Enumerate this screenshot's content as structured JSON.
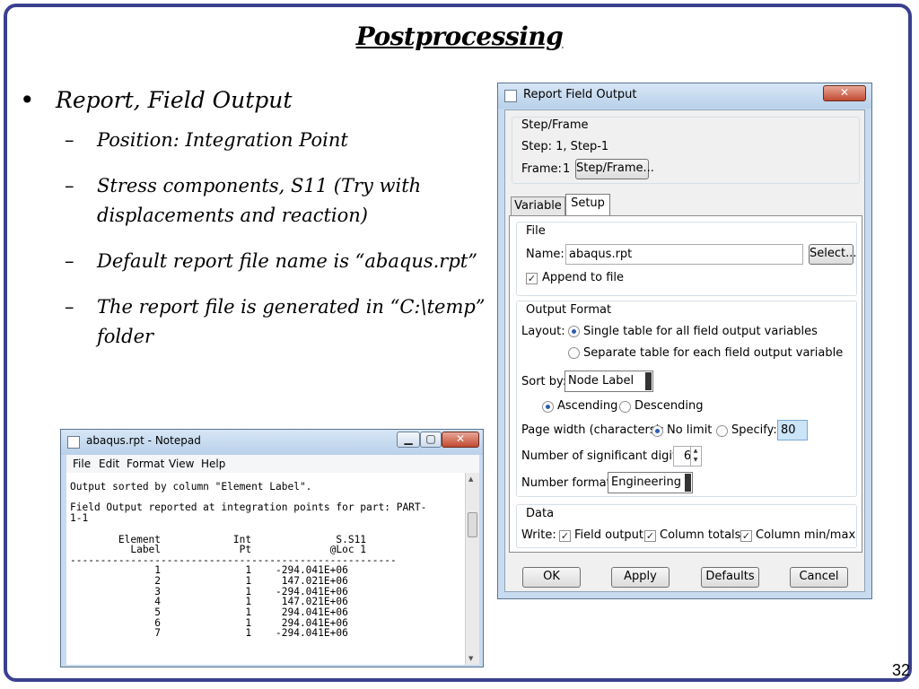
{
  "slide": {
    "title": "Postprocessing",
    "bullet": "Report, Field Output",
    "subs": [
      "Position: Integration Point",
      "Stress components, S11 (Try with displacements and reaction)",
      "Default report file name is “abaqus.rpt”",
      "The report file is generated in “C:\\temp” folder"
    ],
    "page_number": "32"
  },
  "dialog": {
    "title": "Report Field Output",
    "step_frame_group": "Step/Frame",
    "step_text": "Step: 1, Step-1",
    "frame_label": "Frame:",
    "frame_value": "1",
    "step_frame_button": "Step/Frame...",
    "tabs": [
      "Variable",
      "Setup"
    ],
    "active_tab": "Setup",
    "file_group": "File",
    "name_label": "Name:",
    "name_value": "abaqus.rpt",
    "select_button": "Select...",
    "append_label": "Append to file",
    "append_checked": true,
    "output_format_group": "Output Format",
    "layout_label": "Layout:",
    "layout_options": [
      "Single table for all field output variables",
      "Separate table for each field output variable"
    ],
    "layout_selected": 0,
    "sort_by_label": "Sort by:",
    "sort_by_value": "Node Label",
    "order_options": [
      "Ascending",
      "Descending"
    ],
    "order_selected": 0,
    "page_width_label": "Page width (characters):",
    "no_limit_label": "No limit",
    "specify_label": "Specify:",
    "page_width_value": "80",
    "sig_digits_label": "Number of significant digits:",
    "sig_digits_value": "6",
    "number_format_label": "Number format:",
    "number_format_value": "Engineering",
    "data_group": "Data",
    "write_label": "Write:",
    "write_options": [
      "Field output",
      "Column totals",
      "Column min/max"
    ],
    "buttons": [
      "OK",
      "Apply",
      "Defaults",
      "Cancel"
    ]
  },
  "notepad": {
    "title": "abaqus.rpt - Notepad",
    "menu": [
      "File",
      "Edit",
      "Format",
      "View",
      "Help"
    ],
    "lines": [
      "",
      "Output sorted by column \"Element Label\".",
      "",
      "Field Output reported at integration points for part: PART-",
      "1-1",
      "",
      "        Element            Int              S.S11",
      "          Label             Pt             @Loc 1",
      "------------------------------------------------------",
      "              1              1    -294.041E+06",
      "              2              1     147.021E+06",
      "              3              1    -294.041E+06",
      "              4              1     147.021E+06",
      "              5              1     294.041E+06",
      "              6              1     294.041E+06",
      "              7              1    -294.041E+06"
    ]
  },
  "colors": {
    "frame_border": "#3a3f8f",
    "window_titlebar": "#c8dbef",
    "close_button": "#c24a31",
    "highlight_field": "#cce4f7"
  },
  "icons": [
    "window-app-icon",
    "minimize-icon",
    "maximize-icon",
    "close-icon",
    "checkbox-checked-icon",
    "radio-selected-icon",
    "dropdown-arrow-icon",
    "spinner-icon"
  ]
}
